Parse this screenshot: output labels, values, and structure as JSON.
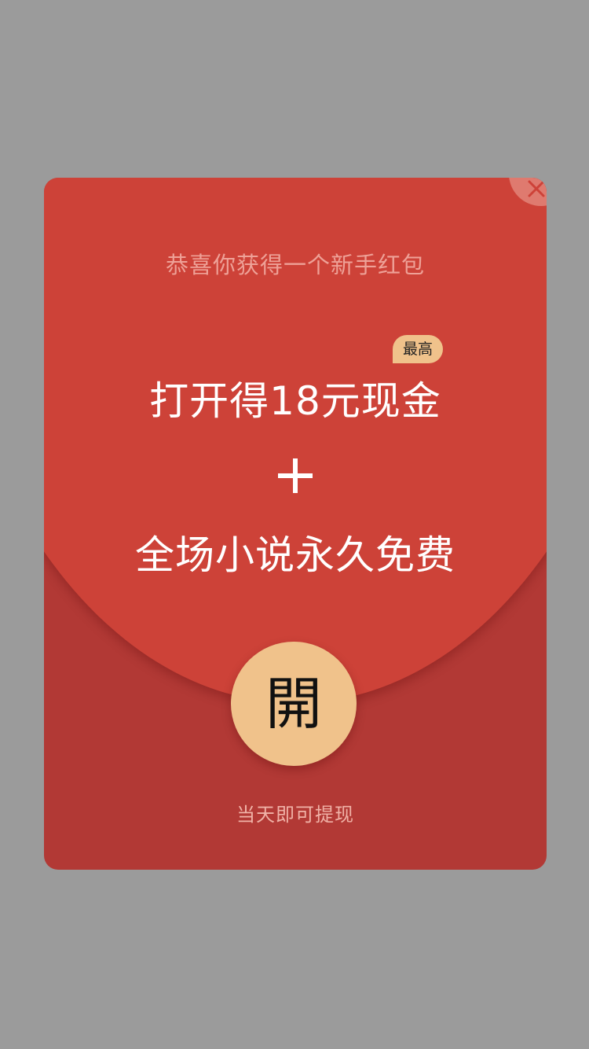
{
  "modal": {
    "subtitle": "恭喜你获得一个新手红包",
    "badge": "最高",
    "headline": "打开得18元现金",
    "subline": "全场小说永久免费",
    "open_label": "開",
    "footer": "当天即可提现"
  },
  "icons": {
    "close": "close-icon",
    "plus": "plus-icon"
  },
  "colors": {
    "backdrop": "#9b9b9b",
    "envelope_top": "#cd4238",
    "envelope_bottom": "#b23935",
    "gold": "#f0c28b",
    "close_bg": "#df7a6f"
  }
}
